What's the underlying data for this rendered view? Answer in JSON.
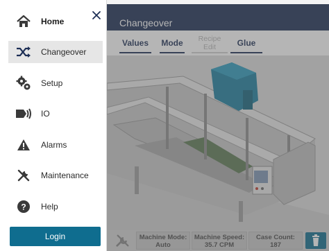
{
  "header": {
    "title": "Changeover"
  },
  "tabs": [
    {
      "label": "Values",
      "enabled": true
    },
    {
      "label": "Mode",
      "enabled": true
    },
    {
      "label": "Recipe Edit",
      "enabled": false
    },
    {
      "label": "Glue",
      "enabled": true
    }
  ],
  "drawer": {
    "items": [
      {
        "label": "Home",
        "icon": "home-icon"
      },
      {
        "label": "Changeover",
        "icon": "shuffle-icon",
        "active": true
      },
      {
        "label": "Setup",
        "icon": "gears-icon"
      },
      {
        "label": "IO",
        "icon": "io-icon"
      },
      {
        "label": "Alarms",
        "icon": "alarm-triangle-icon"
      },
      {
        "label": "Maintenance",
        "icon": "tools-icon"
      },
      {
        "label": "Help",
        "icon": "help-icon"
      }
    ],
    "login_label": "Login"
  },
  "status": {
    "machine_mode_label": "Machine Mode:",
    "machine_mode_value": "Auto",
    "machine_speed_label": "Machine Speed:",
    "machine_speed_value": "35.7 CPM",
    "case_count_label": "Case Count:",
    "case_count_value": "187"
  },
  "colors": {
    "navy": "#1d2f55",
    "teal": "#0f6d8f",
    "active_bg": "#e6e6e6"
  }
}
